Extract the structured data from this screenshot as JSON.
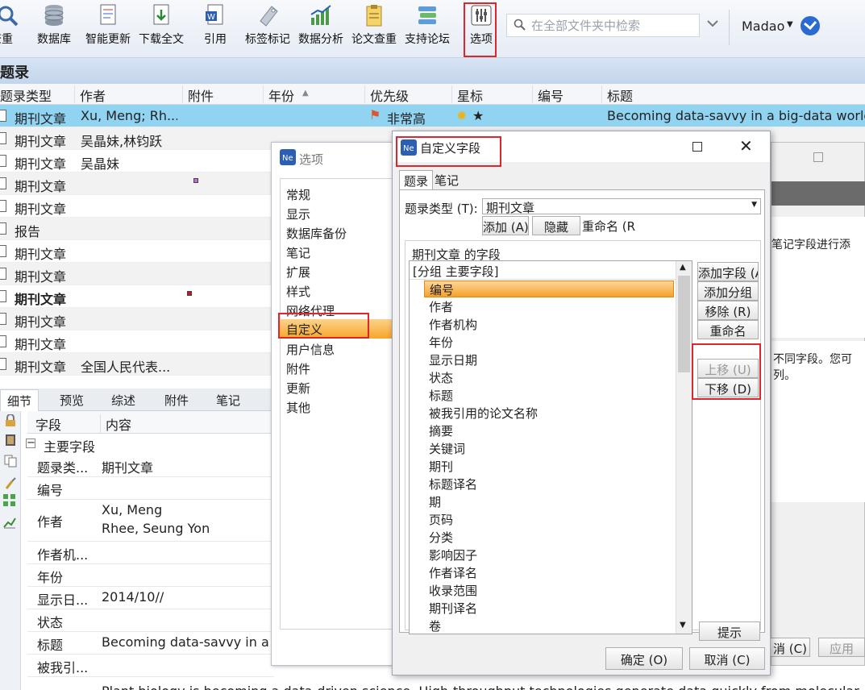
{
  "toolbar": {
    "items": [
      {
        "label": "查重"
      },
      {
        "label": "数据库"
      },
      {
        "label": "智能更新"
      },
      {
        "label": "下载全文"
      },
      {
        "label": "引用"
      },
      {
        "label": "标签标记"
      },
      {
        "label": "数据分析"
      },
      {
        "label": "论文查重"
      },
      {
        "label": "支持论坛"
      },
      {
        "label": "选项"
      }
    ],
    "search_placeholder": "在全部文件夹中检索",
    "user": "Madao"
  },
  "section_title": "题录",
  "columns": [
    "题录类型",
    "作者",
    "附件",
    "年份",
    "优先级",
    "星标",
    "编号",
    "标题"
  ],
  "rows": [
    {
      "type": "期刊文章",
      "author": "Xu, Meng; Rh...",
      "priority": "非常高",
      "star": "★",
      "title": "Becoming data-savvy in a big-data world"
    },
    {
      "type": "期刊文章",
      "author": "吴晶妹,林钧跃",
      "priority": "",
      "star": "",
      "title": ""
    },
    {
      "type": "期刊文章",
      "author": "吴晶妹",
      "priority": "",
      "star": "",
      "title": ""
    },
    {
      "type": "期刊文章",
      "author": "",
      "priority": "",
      "star": "",
      "title": ""
    },
    {
      "type": "期刊文章",
      "author": "",
      "priority": "",
      "star": "",
      "title": ""
    },
    {
      "type": "报告",
      "author": "",
      "priority": "",
      "star": "",
      "title": ""
    },
    {
      "type": "期刊文章",
      "author": "",
      "priority": "",
      "star": "",
      "title": ""
    },
    {
      "type": "期刊文章",
      "author": "",
      "priority": "",
      "star": "",
      "title": ""
    },
    {
      "type": "期刊文章",
      "author": "",
      "priority": "",
      "star": "",
      "title": ""
    },
    {
      "type": "期刊文章",
      "author": "",
      "priority": "",
      "star": "",
      "title": ""
    },
    {
      "type": "期刊文章",
      "author": "",
      "priority": "",
      "star": "",
      "title": ""
    },
    {
      "type": "期刊文章",
      "author": "全国人民代表...",
      "priority": "",
      "star": "",
      "title": ""
    }
  ],
  "detail_tabs": [
    "细节",
    "预览",
    "综述",
    "附件",
    "笔记"
  ],
  "detail": {
    "col_field": "字段",
    "col_content": "内容",
    "group": "主要字段",
    "rows": [
      {
        "k": "题录类...",
        "v": "期刊文章"
      },
      {
        "k": "编号",
        "v": ""
      },
      {
        "k": "作者",
        "v": "Xu, Meng",
        "v2": "Rhee, Seung Yon"
      },
      {
        "k": "作者机...",
        "v": ""
      },
      {
        "k": "年份",
        "v": ""
      },
      {
        "k": "显示日...",
        "v": "2014/10//"
      },
      {
        "k": "状态",
        "v": ""
      },
      {
        "k": "标题",
        "v": "Becoming data-savvy in a big-data world"
      },
      {
        "k": "被我引...",
        "v": ""
      }
    ],
    "abstract": "Plant biology is becoming a data-driven science. High-throughput technologies generate data quickly from molecular"
  },
  "options_dialog": {
    "title": "选项",
    "items": [
      "常规",
      "显示",
      "数据库备份",
      "笔记",
      "扩展",
      "样式",
      "网络代理",
      "自定义",
      "用户信息",
      "附件",
      "更新",
      "其他"
    ],
    "selected": "自定义"
  },
  "bg_dialog": {
    "text1": "笔记字段进行添",
    "text2": "不同字段。您可",
    "text3": "列。",
    "cancel": "消 (C)",
    "apply": "应用"
  },
  "custom_dialog": {
    "title": "自定义字段",
    "tabs": [
      "题录",
      "笔记"
    ],
    "type_label": "题录类型 (T):",
    "type_value": "期刊文章",
    "add": "添加 (A)",
    "hide": "隐藏",
    "rename": "重命名 (R",
    "group_title": "期刊文章 的字段",
    "group_header": "[分组 主要字段]",
    "fields": [
      "编号",
      "作者",
      "作者机构",
      "年份",
      "显示日期",
      "状态",
      "标题",
      "被我引用的论文名称",
      "摘要",
      "关键词",
      "期刊",
      "标题译名",
      "期",
      "页码",
      "分类",
      "影响因子",
      "作者译名",
      "收录范围",
      "期刊译名",
      "卷"
    ],
    "selected_field": "编号",
    "side_buttons": [
      "添加字段 (A",
      "添加分组",
      "移除 (R)",
      "重命名"
    ],
    "move_up": "上移 (U)",
    "move_down": "下移 (D)",
    "hint": "提示",
    "ok": "确定 (O)",
    "cancel": "取消 (C)"
  }
}
